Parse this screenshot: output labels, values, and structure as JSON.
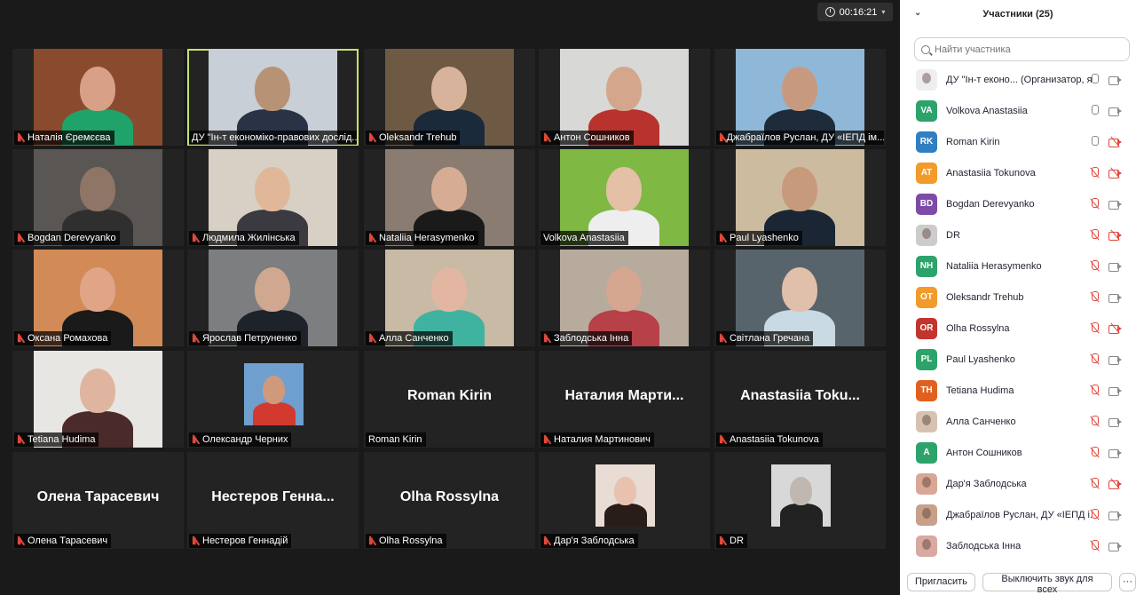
{
  "timer": {
    "value": "00:16:21",
    "caret": "▾"
  },
  "tiles": [
    {
      "name": "Наталія Єремєєва",
      "muted": true,
      "type": "video",
      "bg": "#8a4a2e",
      "skin": "#d9a088",
      "shirt": "#1fa36a"
    },
    {
      "name": "ДУ \"Ін-т економіко-правових дослід...",
      "muted": false,
      "type": "video",
      "bg": "#c9cfd6",
      "skin": "#b89274",
      "shirt": "#2a3346",
      "active": true
    },
    {
      "name": "Oleksandr Trehub",
      "muted": true,
      "type": "video",
      "bg": "#6e5a44",
      "skin": "#d8b39c",
      "shirt": "#1a2a3a"
    },
    {
      "name": "Антон Сошников",
      "muted": true,
      "type": "video",
      "bg": "#d8d8d6",
      "skin": "#d4a68b",
      "shirt": "#b8332e"
    },
    {
      "name": "Джабраїлов Руслан, ДУ «ІЕПД ім...",
      "muted": true,
      "type": "video",
      "bg": "#8fb8d8",
      "skin": "#c79a80",
      "shirt": "#1e2b3b"
    },
    {
      "name": "Bogdan Derevyanko",
      "muted": true,
      "type": "video",
      "bg": "#5a5654",
      "skin": "#8f7566",
      "shirt": "#2f2f2f"
    },
    {
      "name": "Людмила Жилінська",
      "muted": true,
      "type": "video",
      "bg": "#d8d0c4",
      "skin": "#e0b899",
      "shirt": "#3a3a40"
    },
    {
      "name": "Nataliia Herasymenko",
      "muted": true,
      "type": "video",
      "bg": "#8a7c70",
      "skin": "#d6ad94",
      "shirt": "#1a1a1a"
    },
    {
      "name": "Volkova Anastasiia",
      "muted": false,
      "type": "video",
      "bg": "#7fb843",
      "skin": "#e3c0a6",
      "shirt": "#eeeeee"
    },
    {
      "name": "Paul Lyashenko",
      "muted": true,
      "type": "video",
      "bg": "#cdbba0",
      "skin": "#c89a7c",
      "shirt": "#1a2633"
    },
    {
      "name": "Оксана Ромахова",
      "muted": true,
      "type": "video",
      "bg": "#d28a56",
      "skin": "#e0a587",
      "shirt": "#1a1a1a"
    },
    {
      "name": "Ярослав Петруненко",
      "muted": true,
      "type": "video",
      "bg": "#7c7e80",
      "skin": "#cfa88f",
      "shirt": "#1e232b"
    },
    {
      "name": "Алла Санченко",
      "muted": true,
      "type": "video",
      "bg": "#c8baa4",
      "skin": "#e2b6a0",
      "shirt": "#3fb3a0"
    },
    {
      "name": "Заблодська Інна",
      "muted": true,
      "type": "video",
      "bg": "#b7ab9e",
      "skin": "#d5a690",
      "shirt": "#b84048"
    },
    {
      "name": "Світлана Гречана",
      "muted": true,
      "type": "video",
      "bg": "#58646c",
      "skin": "#e0c0aa",
      "shirt": "#c9d9e4"
    },
    {
      "name": "Tetiana Hudima",
      "muted": true,
      "type": "video",
      "bg": "#e8e6e2",
      "skin": "#e0b5a0",
      "shirt": "#4a2a2a"
    },
    {
      "name": "Олександр Черних",
      "muted": true,
      "type": "avatar",
      "avatarBg": "#6f9fcf",
      "skin": "#cf9a7c",
      "shirt": "#d23a2f"
    },
    {
      "name": "Roman Kirin",
      "muted": false,
      "type": "name",
      "big": "Roman Kirin"
    },
    {
      "name": "Наталия Мартинович",
      "muted": true,
      "type": "name",
      "big": "Наталия  Марти..."
    },
    {
      "name": "Anastasiia Tokunova",
      "muted": true,
      "type": "name",
      "big": "Anastasiia  Toku..."
    },
    {
      "name": "Олена Тарасевич",
      "muted": true,
      "type": "name",
      "big": "Олена Тарасевич"
    },
    {
      "name": "Нестеров Геннадій",
      "muted": true,
      "type": "name",
      "big": "Нестеров  Генна..."
    },
    {
      "name": "Olha Rossylna",
      "muted": true,
      "type": "name",
      "big": "Olha Rossylna"
    },
    {
      "name": "Дар'я Заблодська",
      "muted": true,
      "type": "avatar",
      "avatarBg": "#e8dcd4",
      "skin": "#e8c2ae",
      "shirt": "#2a1c18"
    },
    {
      "name": "DR",
      "muted": true,
      "type": "avatar",
      "avatarBg": "#d8d8d8",
      "skin": "#c0b8b0",
      "shirt": "#222222"
    }
  ],
  "panel": {
    "title": "Участники (25)",
    "collapse_icon": "chevron-down-icon",
    "search_placeholder": "Найти участника",
    "participants": [
      {
        "initials": "",
        "color": "#eeeeee",
        "name": "ДУ \"Ін-т еконо...  (Организатор, я)",
        "mic": "on",
        "cam": "on",
        "img": true
      },
      {
        "initials": "VA",
        "color": "#2ca36a",
        "name": "Volkova Anastasiia",
        "mic": "on",
        "cam": "on"
      },
      {
        "initials": "RK",
        "color": "#2f7fc2",
        "name": "Roman Kirin",
        "mic": "on",
        "cam": "off"
      },
      {
        "initials": "AT",
        "color": "#f29b2c",
        "name": "Anastasiia Tokunova",
        "mic": "off",
        "cam": "off"
      },
      {
        "initials": "BD",
        "color": "#7d4aa8",
        "name": "Bogdan Derevyanko",
        "mic": "off",
        "cam": "on"
      },
      {
        "initials": "",
        "color": "#cccccc",
        "name": "DR",
        "mic": "off",
        "cam": "off",
        "img": true
      },
      {
        "initials": "NH",
        "color": "#2ca36a",
        "name": "Nataliia Herasymenko",
        "mic": "off",
        "cam": "on"
      },
      {
        "initials": "OT",
        "color": "#f29b2c",
        "name": "Oleksandr Trehub",
        "mic": "off",
        "cam": "on"
      },
      {
        "initials": "OR",
        "color": "#c2352f",
        "name": "Olha Rossylna",
        "mic": "off",
        "cam": "off"
      },
      {
        "initials": "PL",
        "color": "#2ca36a",
        "name": "Paul Lyashenko",
        "mic": "off",
        "cam": "on"
      },
      {
        "initials": "TH",
        "color": "#e0611f",
        "name": "Tetiana Hudima",
        "mic": "off",
        "cam": "on"
      },
      {
        "initials": "",
        "color": "#d7c2b2",
        "name": "Алла Санченко",
        "mic": "off",
        "cam": "on",
        "img": true
      },
      {
        "initials": "A",
        "color": "#2ca36a",
        "name": "Антон Сошников",
        "mic": "off",
        "cam": "on"
      },
      {
        "initials": "",
        "color": "#d9a796",
        "name": "Дар'я Заблодська",
        "mic": "off",
        "cam": "off",
        "img": true
      },
      {
        "initials": "",
        "color": "#c8a08a",
        "name": "Джабраїлов Руслан, ДУ «ІЕПД і...",
        "mic": "off",
        "cam": "on",
        "img": true
      },
      {
        "initials": "",
        "color": "#d7a9a0",
        "name": "Заблодська Інна",
        "mic": "off",
        "cam": "on",
        "img": true
      }
    ],
    "invite_label": "Пригласить",
    "mute_all_label": "Выключить звук для всех",
    "more_label": "···"
  }
}
